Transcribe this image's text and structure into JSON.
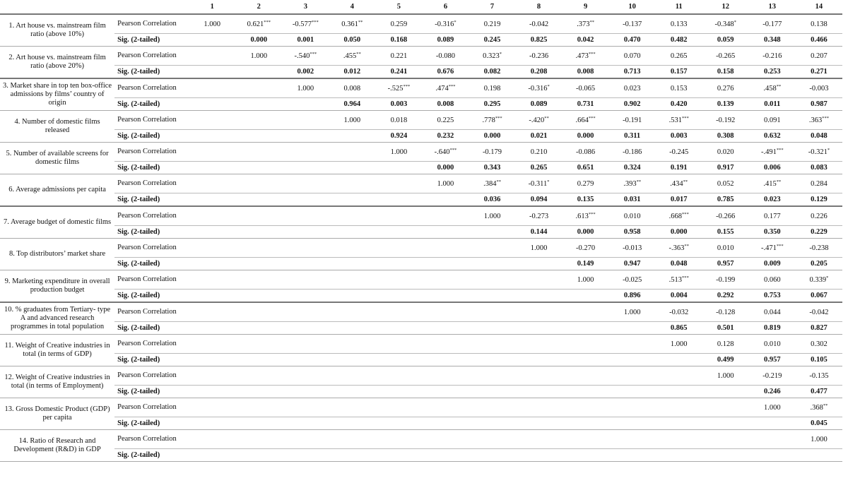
{
  "columns": [
    "1",
    "2",
    "3",
    "4",
    "5",
    "6",
    "7",
    "8",
    "9",
    "10",
    "11",
    "12",
    "13",
    "14"
  ],
  "stat_labels": {
    "pearson": "Pearson Correlation",
    "sig": "Sig. (2-tailed)"
  },
  "rows": [
    {
      "label": "1. Art house vs. mainstream film ratio (above 10%)",
      "thick": false,
      "pearson": [
        "1.000",
        "0.621***",
        "-0.577***",
        "0.361**",
        "0.259",
        "-0.316*",
        "0.219",
        "-0.042",
        ".373**",
        "-0.137",
        "0.133",
        "-0.348*",
        "-0.177",
        "0.138"
      ],
      "sig": [
        "",
        "0.000",
        "0.001",
        "0.050",
        "0.168",
        "0.089",
        "0.245",
        "0.825",
        "0.042",
        "0.470",
        "0.482",
        "0.059",
        "0.348",
        "0.466"
      ]
    },
    {
      "label": "2. Art house vs. mainstream film ratio (above 20%)",
      "thick": true,
      "pearson": [
        "",
        "1.000",
        "-.540***",
        ".455**",
        "0.221",
        "-0.080",
        "0.323*",
        "-0.236",
        ".473***",
        "0.070",
        "0.265",
        "-0.265",
        "-0.216",
        "0.207"
      ],
      "sig": [
        "",
        "",
        "0.002",
        "0.012",
        "0.241",
        "0.676",
        "0.082",
        "0.208",
        "0.008",
        "0.713",
        "0.157",
        "0.158",
        "0.253",
        "0.271"
      ]
    },
    {
      "label": "3. Market share in top ten box-office admissions by films’ country of origin",
      "thick": false,
      "pearson": [
        "",
        "",
        "1.000",
        "0.008",
        "-.525***",
        ".474***",
        "0.198",
        "-0.316*",
        "-0.065",
        "0.023",
        "0.153",
        "0.276",
        ".458**",
        "-0.003"
      ],
      "sig": [
        "",
        "",
        "",
        "0.964",
        "0.003",
        "0.008",
        "0.295",
        "0.089",
        "0.731",
        "0.902",
        "0.420",
        "0.139",
        "0.011",
        "0.987"
      ]
    },
    {
      "label": "4. Number of domestic films released",
      "thick": false,
      "pearson": [
        "",
        "",
        "",
        "1.000",
        "0.018",
        "0.225",
        ".778***",
        "-.420**",
        ".664***",
        "-0.191",
        ".531***",
        "-0.192",
        "0.091",
        ".363***"
      ],
      "sig": [
        "",
        "",
        "",
        "",
        "0.924",
        "0.232",
        "0.000",
        "0.021",
        "0.000",
        "0.311",
        "0.003",
        "0.308",
        "0.632",
        "0.048"
      ]
    },
    {
      "label": "5. Number of available screens for domestic films",
      "thick": false,
      "pearson": [
        "",
        "",
        "",
        "",
        "1.000",
        "-.640***",
        "-0.179",
        "0.210",
        "-0.086",
        "-0.186",
        "-0.245",
        "0.020",
        "-.491***",
        "-0.321*"
      ],
      "sig": [
        "",
        "",
        "",
        "",
        "",
        "0.000",
        "0.343",
        "0.265",
        "0.651",
        "0.324",
        "0.191",
        "0.917",
        "0.006",
        "0.083"
      ]
    },
    {
      "label": "6. Average admissions per capita",
      "thick": true,
      "pearson": [
        "",
        "",
        "",
        "",
        "",
        "1.000",
        ".384**",
        "-0.311*",
        "0.279",
        ".393**",
        ".434**",
        "0.052",
        ".415**",
        "0.284"
      ],
      "sig": [
        "",
        "",
        "",
        "",
        "",
        "",
        "0.036",
        "0.094",
        "0.135",
        "0.031",
        "0.017",
        "0.785",
        "0.023",
        "0.129"
      ]
    },
    {
      "label": "7. Average budget of domestic films",
      "thick": false,
      "pearson": [
        "",
        "",
        "",
        "",
        "",
        "",
        "1.000",
        "-0.273",
        ".613***",
        "0.010",
        ".668***",
        "-0.266",
        "0.177",
        "0.226"
      ],
      "sig": [
        "",
        "",
        "",
        "",
        "",
        "",
        "",
        "0.144",
        "0.000",
        "0.958",
        "0.000",
        "0.155",
        "0.350",
        "0.229"
      ]
    },
    {
      "label": "8. Top distributors’ market share",
      "thick": false,
      "pearson": [
        "",
        "",
        "",
        "",
        "",
        "",
        "",
        "1.000",
        "-0.270",
        "-0.013",
        "-.363**",
        "0.010",
        "-.471***",
        "-0.238"
      ],
      "sig": [
        "",
        "",
        "",
        "",
        "",
        "",
        "",
        "",
        "0.149",
        "0.947",
        "0.048",
        "0.957",
        "0.009",
        "0.205"
      ]
    },
    {
      "label": "9. Marketing expenditure in overall production budget",
      "thick": true,
      "pearson": [
        "",
        "",
        "",
        "",
        "",
        "",
        "",
        "",
        "1.000",
        "-0.025",
        ".513***",
        "-0.199",
        "0.060",
        "0.339*"
      ],
      "sig": [
        "",
        "",
        "",
        "",
        "",
        "",
        "",
        "",
        "",
        "0.896",
        "0.004",
        "0.292",
        "0.753",
        "0.067"
      ]
    },
    {
      "label": "10. % graduates from Tertiary- type A and advanced research programmes in total population",
      "thick": false,
      "pearson": [
        "",
        "",
        "",
        "",
        "",
        "",
        "",
        "",
        "",
        "1.000",
        "-0.032",
        "-0.128",
        "0.044",
        "-0.042"
      ],
      "sig": [
        "",
        "",
        "",
        "",
        "",
        "",
        "",
        "",
        "",
        "",
        "0.865",
        "0.501",
        "0.819",
        "0.827"
      ]
    },
    {
      "label": "11. Weight of Creative industries in total (in terms of GDP)",
      "thick": false,
      "pearson": [
        "",
        "",
        "",
        "",
        "",
        "",
        "",
        "",
        "",
        "",
        "1.000",
        "0.128",
        "0.010",
        "0.302"
      ],
      "sig": [
        "",
        "",
        "",
        "",
        "",
        "",
        "",
        "",
        "",
        "",
        "",
        "0.499",
        "0.957",
        "0.105"
      ]
    },
    {
      "label": "12. Weight of Creative industries in total (in terms of Employment)",
      "thick": false,
      "pearson": [
        "",
        "",
        "",
        "",
        "",
        "",
        "",
        "",
        "",
        "",
        "",
        "1.000",
        "-0.219",
        "-0.135"
      ],
      "sig": [
        "",
        "",
        "",
        "",
        "",
        "",
        "",
        "",
        "",
        "",
        "",
        "",
        "0.246",
        "0.477"
      ]
    },
    {
      "label": "13. Gross Domestic Product (GDP) per capita",
      "thick": false,
      "pearson": [
        "",
        "",
        "",
        "",
        "",
        "",
        "",
        "",
        "",
        "",
        "",
        "",
        "1.000",
        ".368**"
      ],
      "sig": [
        "",
        "",
        "",
        "",
        "",
        "",
        "",
        "",
        "",
        "",
        "",
        "",
        "",
        "0.045"
      ]
    },
    {
      "label": "14. Ratio of Research and Development (R&D) in GDP",
      "thick": false,
      "pearson": [
        "",
        "",
        "",
        "",
        "",
        "",
        "",
        "",
        "",
        "",
        "",
        "",
        "",
        "1.000"
      ],
      "sig": [
        "",
        "",
        "",
        "",
        "",
        "",
        "",
        "",
        "",
        "",
        "",
        "",
        "",
        ""
      ]
    }
  ]
}
